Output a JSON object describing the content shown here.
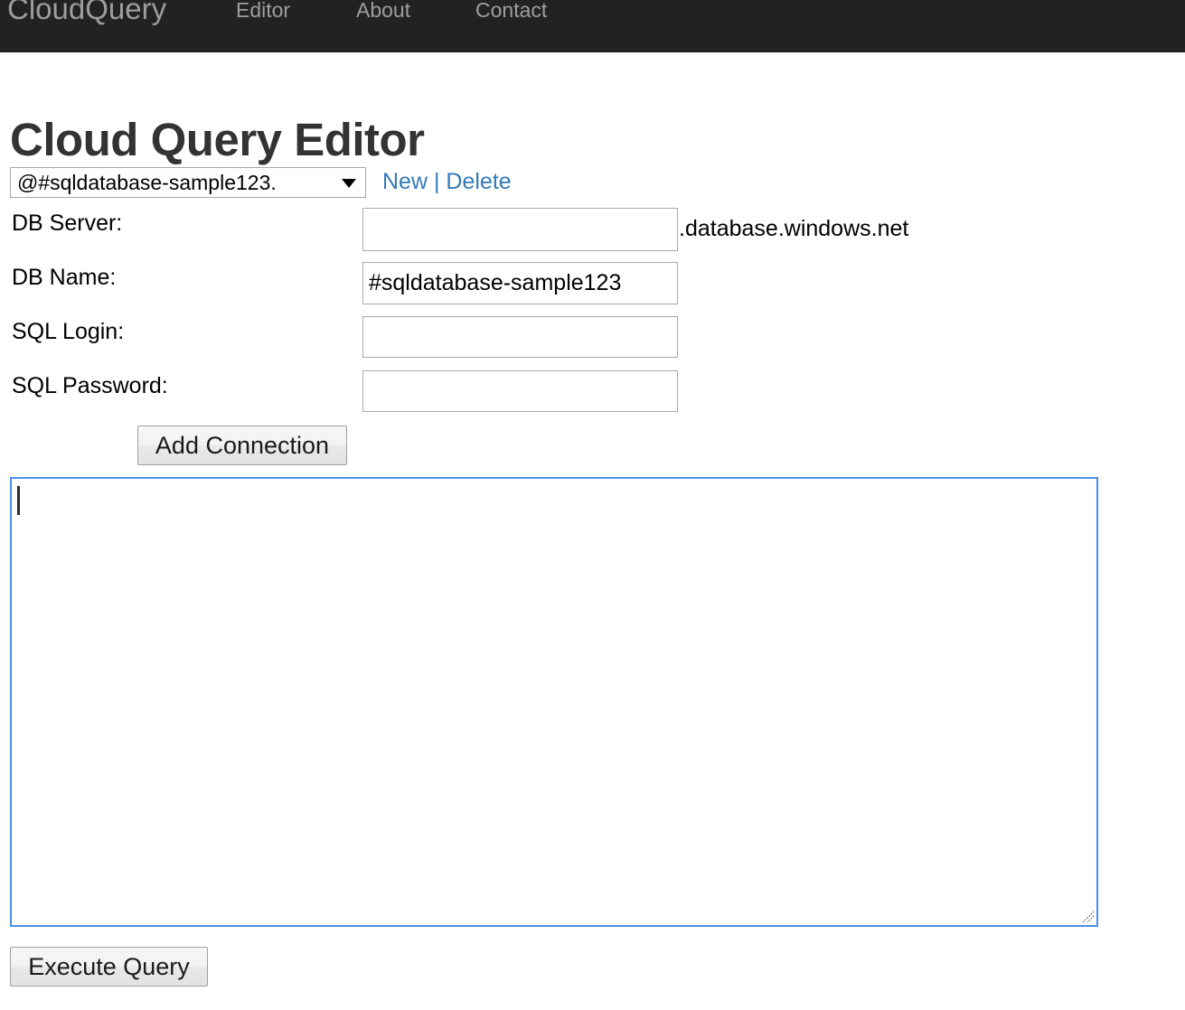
{
  "navbar": {
    "brand": "CloudQuery",
    "links": [
      {
        "label": "Editor"
      },
      {
        "label": "About"
      },
      {
        "label": "Contact"
      }
    ],
    "background_color": "#222222",
    "text_color": "#9d9d9d"
  },
  "page": {
    "title": "Cloud Query Editor",
    "title_color": "#333333"
  },
  "connection": {
    "selected_option": "@#sqldatabase-sample123.",
    "options": [
      "@#sqldatabase-sample123."
    ],
    "new_label": "New",
    "separator": "|",
    "delete_label": "Delete",
    "link_color": "#337ab7"
  },
  "form": {
    "fields": [
      {
        "label": "DB Server:",
        "value": "",
        "placeholder": "",
        "suffix": ".database.windows.net"
      },
      {
        "label": "DB Name:",
        "value": "#sqldatabase-sample123",
        "placeholder": ""
      },
      {
        "label": "SQL Login:",
        "value": "",
        "placeholder": ""
      },
      {
        "label": "SQL Password:",
        "value": "",
        "placeholder": ""
      }
    ],
    "add_connection_label": "Add Connection"
  },
  "query": {
    "value": "",
    "placeholder": "",
    "focused": true,
    "focus_border_color": "#4a90e8",
    "execute_label": "Execute Query"
  }
}
